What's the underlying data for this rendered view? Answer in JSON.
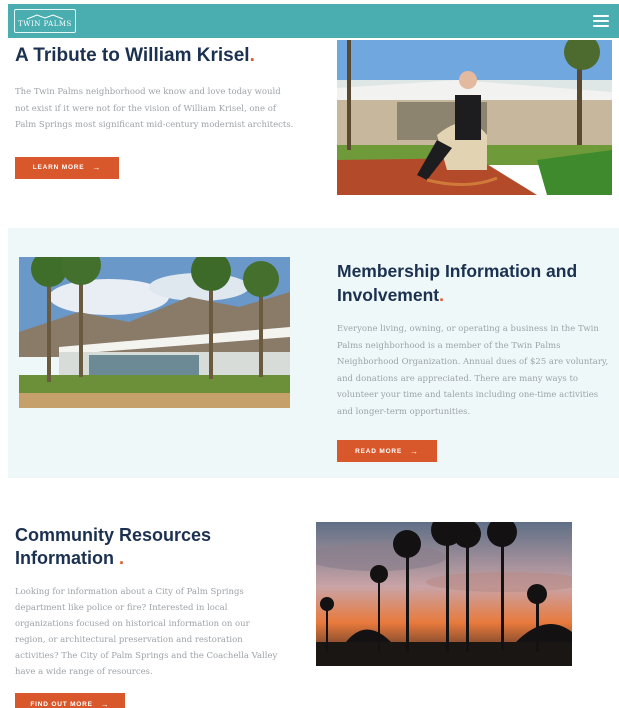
{
  "header": {
    "logo_text": "TWIN PALMS",
    "logo_icon": "palm-roof-icon",
    "menu_icon": "hamburger-menu-icon",
    "bar_color": "#4aaeb0"
  },
  "tribute": {
    "title": "A Tribute to William Krisel",
    "title_dot": ".",
    "body": "The Twin Palms neighborhood we know and love today would not exist if it were not for the vision of William Krisel, one of Palm Springs most significant mid-century modernist architects.",
    "button_label": "LEARN MORE",
    "button_arrow": "→"
  },
  "membership": {
    "title": "Membership Information and Involvement",
    "title_dot": ".",
    "body": "Everyone living, owning, or operating a business in the Twin Palms neighborhood is a member of the Twin Palms Neighborhood Organization. Annual dues of $25 are voluntary, and donations are appreciated. There are many ways to volunteer your time and talents including one-time activities and longer-term opportunities.",
    "button_label": "READ MORE",
    "button_arrow": "→"
  },
  "resources": {
    "title": "Community Resources Information",
    "title_dot": ".",
    "body": "Looking for information about a City of Palm Springs department like police or fire? Interested in local organizations focused on historical information on our region, or architectural preservation and restoration activities? The City of Palm Springs and the Coachella Valley have a wide range of resources.",
    "button_label": "FIND OUT MORE",
    "button_arrow": "→"
  },
  "colors": {
    "accent": "#d9582b",
    "heading": "#1c3150",
    "band": "#eef8f9"
  }
}
